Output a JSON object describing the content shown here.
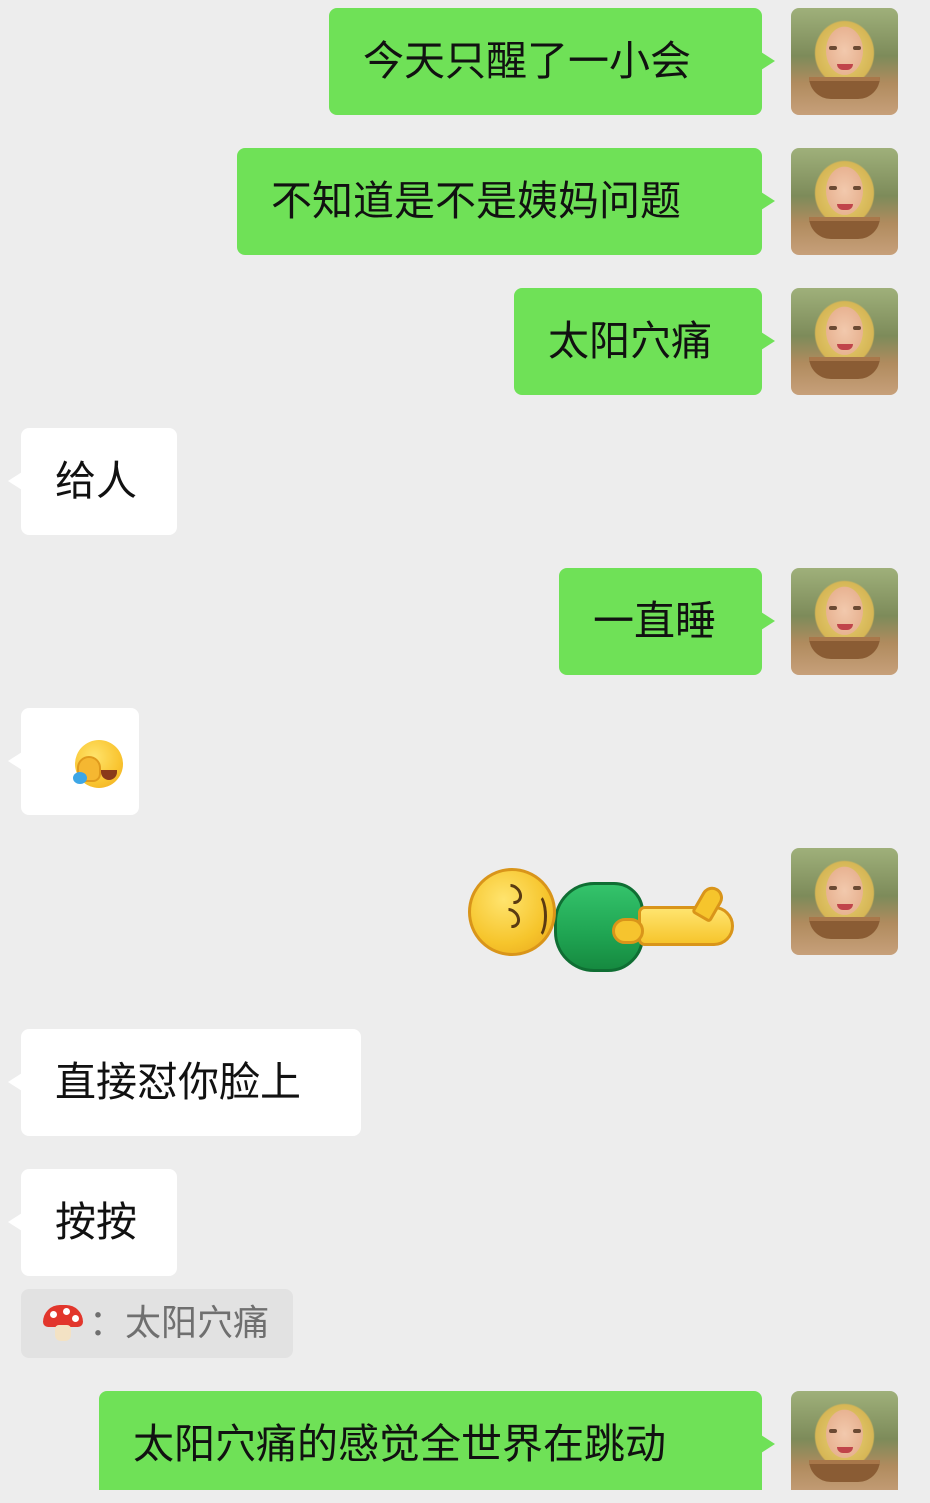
{
  "messages": [
    {
      "text": "今天只醒了一小会"
    },
    {
      "text": "不知道是不是姨妈问题"
    },
    {
      "text": "太阳穴痛"
    },
    {
      "text": "给人"
    },
    {
      "text": "一直睡"
    },
    {
      "emoji": "face-palm-crying-emoji"
    },
    {
      "sticker": "lying-down-emoji-sticker"
    },
    {
      "text": "直接怼你脸上"
    },
    {
      "text": "按按"
    },
    {
      "text": "太阳穴痛的感觉全世界在跳动"
    }
  ],
  "quote": {
    "icon": "mushroom-icon",
    "separator": "：",
    "text": "太阳穴痛"
  },
  "colors": {
    "background": "#ededed",
    "outgoing_bubble": "#6fe157",
    "incoming_bubble": "#ffffff",
    "quote_bg": "#e2e2e2"
  }
}
